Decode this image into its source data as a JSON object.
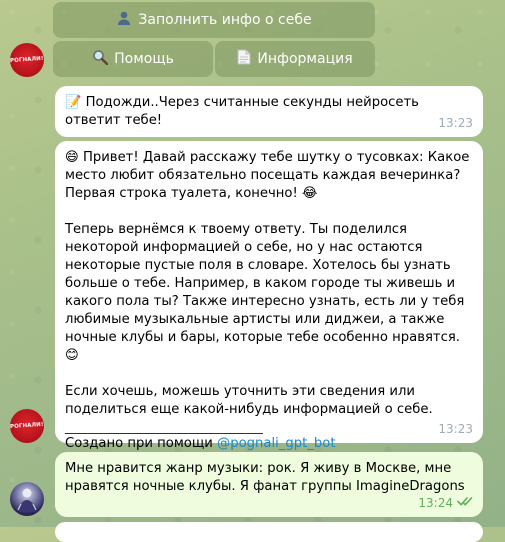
{
  "keyboard": {
    "fill_info": {
      "icon": "user-icon",
      "label": "Заполнить инфо о себе"
    },
    "help": {
      "icon": "magnifier-icon",
      "label": "Помощь"
    },
    "info": {
      "icon": "document-icon",
      "label": "Информация"
    }
  },
  "bot": {
    "avatar_text": "PОГНАЛИ!"
  },
  "messages": {
    "waiting": {
      "text": "📝 Подожди..Через считанные секунды нейросеть ответит тебе!",
      "time": "13:23"
    },
    "joke": {
      "p1": "😄 Привет! Давай расскажу тебе шутку о тусовках: Какое место любит обязательно посещать каждая вечеринка? Первая строка туалета, конечно! 😂",
      "p2": "Теперь вернёмся к твоему ответу. Ты поделился некоторой информацией о себе, но у нас остаются некоторые пустые поля в словаре. Хотелось бы узнать больше о тебе. Например, в каком городе ты живешь и какого пола ты? Также интересно узнать, есть ли у тебя любимые музыкальные артисты или диджеи, а также ночные клубы и бары, которые тебе особенно нравятся. 😊",
      "p3": "Если хочешь, можешь уточнить эти сведения или поделиться еще какой-нибудь информацией о себе.",
      "divider": "______________________________",
      "footer_prefix": "Создано при помощи ",
      "footer_link": "@pognali_gpt_bot",
      "time": "13:23"
    },
    "user": {
      "text": "Мне нравится жанр музыки: рок. Я живу в Москве, мне нравятся ночные клубы. Я фанат группы ImagineDragons",
      "time": "13:24",
      "status": "read"
    }
  },
  "colors": {
    "incoming_bubble": "#ffffff",
    "outgoing_bubble": "#effdde",
    "link": "#168acd",
    "time_incoming": "#a0acb6",
    "time_outgoing": "#5fae5d",
    "keyboard_button": "#7e9660"
  }
}
